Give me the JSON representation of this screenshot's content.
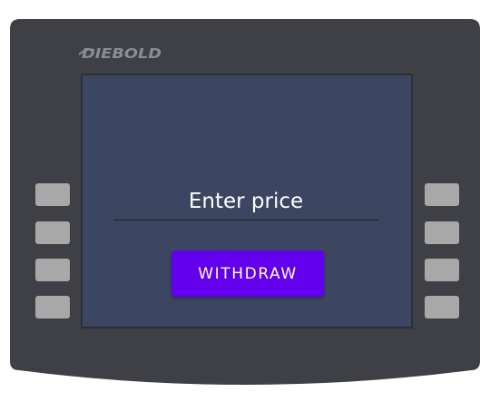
{
  "brand": {
    "name": "DIEBOLD"
  },
  "screen": {
    "price_placeholder": "Enter price",
    "price_value": "",
    "withdraw_label": "WITHDRAW"
  },
  "colors": {
    "bezel": "#3f4046",
    "screen": "#3c4661",
    "side_key": "#a8a8a8",
    "withdraw_button": "#6200ee",
    "logo": "#8a8c90"
  }
}
